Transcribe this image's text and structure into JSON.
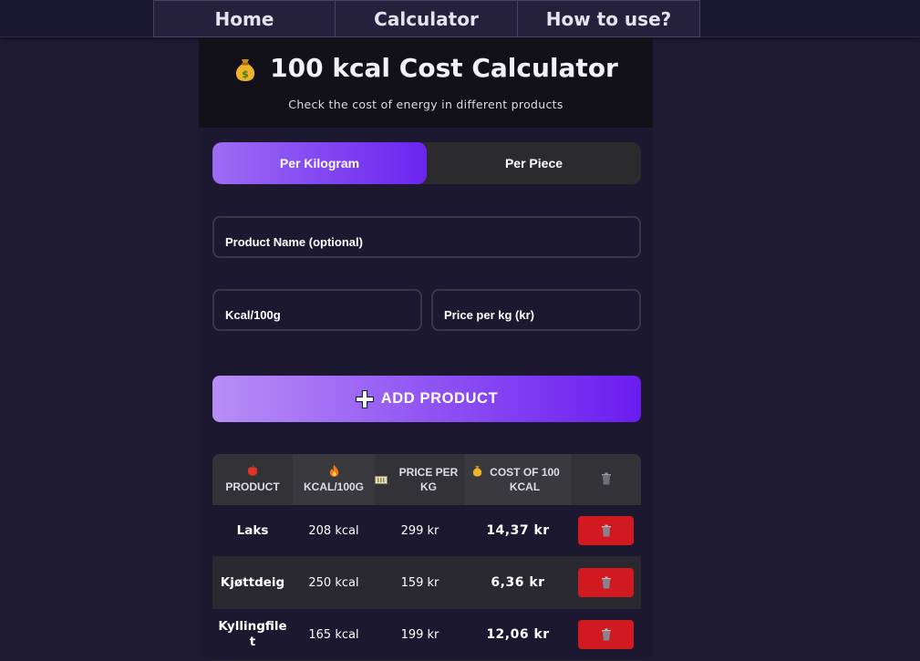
{
  "nav": {
    "items": [
      {
        "label": "Home"
      },
      {
        "label": "Calculator"
      },
      {
        "label": "How to use?"
      }
    ]
  },
  "header": {
    "icon": "money-bag-icon",
    "title": "100 kcal Cost Calculator",
    "subtitle": "Check the cost of energy in different products"
  },
  "mode_tabs": {
    "items": [
      {
        "label": "Per Kilogram",
        "active": true
      },
      {
        "label": "Per Piece",
        "active": false
      }
    ]
  },
  "form": {
    "product_name": {
      "label": "Product Name (optional)",
      "value": ""
    },
    "kcal": {
      "label": "Kcal/100g",
      "value": ""
    },
    "price": {
      "label": "Price per kg (kr)",
      "value": ""
    },
    "add_button": {
      "icon": "plus-icon",
      "label": "ADD PRODUCT"
    }
  },
  "table": {
    "headers": [
      {
        "icon": "apple-icon",
        "label": "PRODUCT"
      },
      {
        "icon": "fire-icon",
        "label": "KCAL/100G"
      },
      {
        "icon": "banknote-icon",
        "label": "PRICE PER KG"
      },
      {
        "icon": "money-bag-icon",
        "label": "COST OF 100 KCAL"
      },
      {
        "icon": "trash-icon",
        "label": ""
      }
    ],
    "rows": [
      {
        "product": "Laks",
        "kcal": "208 kcal",
        "price": "299 kr",
        "cost": "14,37 kr"
      },
      {
        "product": "Kjøttdeig",
        "kcal": "250 kcal",
        "price": "159 kr",
        "cost": "6,36 kr"
      },
      {
        "product": "Kyllingfilet",
        "kcal": "165 kcal",
        "price": "199 kr",
        "cost": "12,06 kr"
      }
    ]
  },
  "colors": {
    "accent_start": "#9d6cf4",
    "accent_end": "#6a24ef",
    "delete": "#d11a1f",
    "background": "#1f1b33"
  }
}
